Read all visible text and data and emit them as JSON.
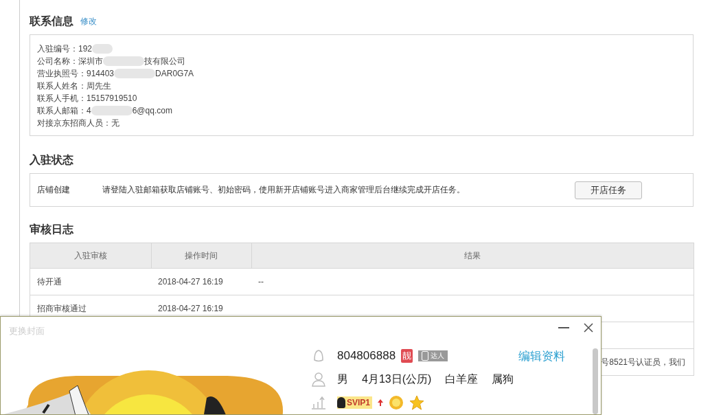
{
  "contact": {
    "title": "联系信息",
    "edit_link": "修改",
    "lines": [
      {
        "label": "入驻编号：",
        "value": "192"
      },
      {
        "label": "公司名称：",
        "value": "深圳市",
        "value_end": "技有限公司"
      },
      {
        "label": "营业执照号：",
        "value": "914403",
        "value_end": "DAR0G7A"
      },
      {
        "label": "联系人姓名：",
        "value": "周先生"
      },
      {
        "label": "联系人手机：",
        "value": "15157919510"
      },
      {
        "label": "联系人邮箱：",
        "value": "4",
        "value_end": "6@qq.com"
      },
      {
        "label": "对接京东招商人员：",
        "value": "无"
      }
    ]
  },
  "status": {
    "title": "入驻状态",
    "step": "店铺创建",
    "message": "请登陆入驻邮箱获取店铺账号、初始密码，使用新开店铺账号进入商家管理后台继续完成开店任务。",
    "button": "开店任务"
  },
  "log": {
    "title": "审核日志",
    "columns": [
      "入驻审核",
      "操作时间",
      "结果"
    ],
    "rows": [
      {
        "step": "待开通",
        "time": "2018-04-27 16:19",
        "result": "--"
      },
      {
        "step": "招商审核通过",
        "time": "2018-04-27 16:19",
        "result": ""
      },
      {
        "step": "",
        "time": "",
        "result": ""
      },
      {
        "step": "",
        "time": "",
        "result": "号8521号认证员，我们"
      }
    ]
  },
  "profile_popup": {
    "cover_label": "更换封面",
    "qq_number": "804806888",
    "pretty_badge": "靓",
    "talent_badge": "达人",
    "edit_link": "编辑资料",
    "gender": "男",
    "birthday": "4月13日(公历)",
    "constellation": "白羊座",
    "zodiac": "属狗",
    "vip_badge": "SVIP1"
  }
}
